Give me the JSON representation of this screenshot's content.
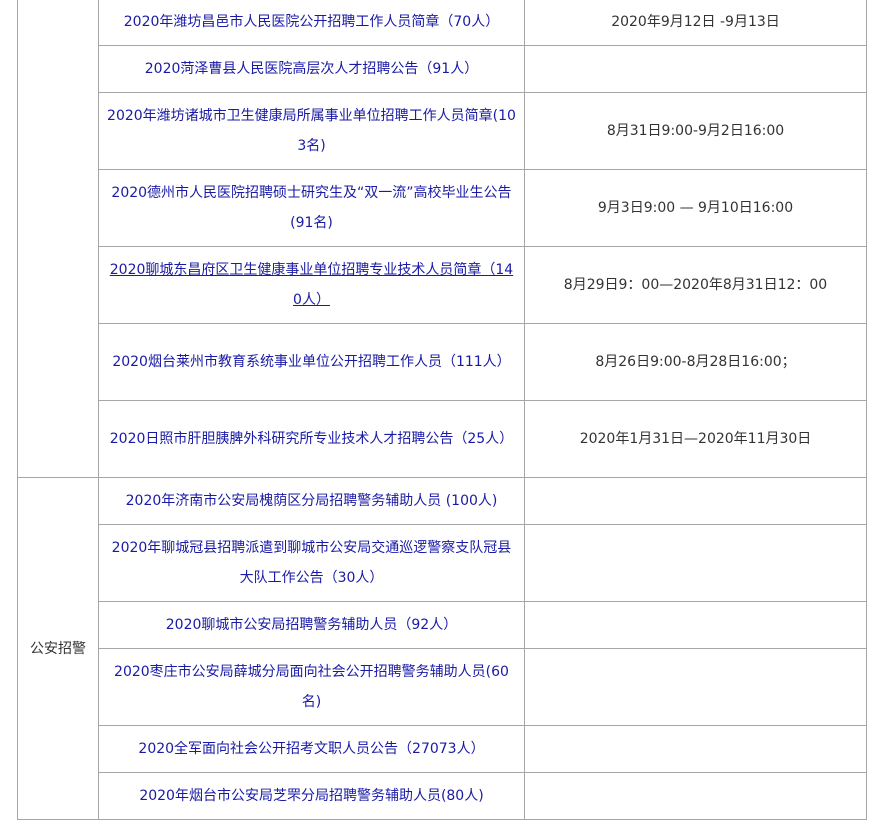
{
  "groups": [
    {
      "category": "",
      "rows": [
        {
          "title": "2020年潍坊昌邑市人民医院公开招聘工作人员简章（70人）",
          "date": "2020年9月12日 -9月13日"
        },
        {
          "title": "2020菏泽曹县人民医院高层次人才招聘公告（91人）",
          "date": ""
        },
        {
          "title": "2020年潍坊诸城市卫生健康局所属事业单位招聘工作人员简章(103名)",
          "date": "8月31日9:00-9月2日16:00"
        },
        {
          "title": "2020德州市人民医院招聘硕士研究生及“双一流”高校毕业生公告(91名)",
          "date": "9月3日9:00 — 9月10日16:00"
        },
        {
          "title": "2020聊城东昌府区卫生健康事业单位招聘专业技术人员简章（140人）",
          "date": "8月29日9：00—2020年8月31日12：00"
        },
        {
          "title": "2020烟台莱州市教育系统事业单位公开招聘工作人员（111人）",
          "date": "8月26日9:00-8月28日16:00；"
        },
        {
          "title": "2020日照市肝胆胰脾外科研究所专业技术人才招聘公告（25人）",
          "date": "2020年1月31日—2020年11月30日"
        }
      ]
    },
    {
      "category": "公安招警",
      "rows": [
        {
          "title": "2020年济南市公安局槐荫区分局招聘警务辅助人员 (100人)",
          "date": ""
        },
        {
          "title": "2020年聊城冠县招聘派遣到聊城市公安局交通巡逻警察支队冠县大队工作公告（30人）",
          "date": ""
        },
        {
          "title": "2020聊城市公安局招聘警务辅助人员（92人）",
          "date": ""
        },
        {
          "title": "2020枣庄市公安局薛城分局面向社会公开招聘警务辅助人员(60名)",
          "date": ""
        },
        {
          "title": "2020全军面向社会公开招考文职人员公告（27073人）",
          "date": ""
        },
        {
          "title": "2020年烟台市公安局芝罘分局招聘警务辅助人员(80人)",
          "date": ""
        }
      ]
    }
  ]
}
